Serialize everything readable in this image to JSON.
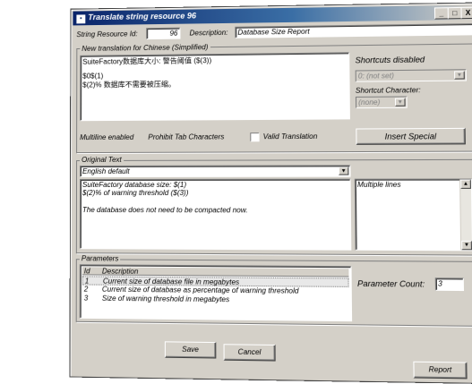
{
  "window": {
    "title": "Translate string resource 96",
    "btn_min": "_",
    "btn_max": "□",
    "btn_close": "X"
  },
  "string_resource": {
    "label": "String Resource Id:",
    "value": "96"
  },
  "description": {
    "label": "Description:",
    "value": "Database Size Report"
  },
  "new_translation": {
    "group_label": "New translation for Chinese (Simplified)",
    "lines": [
      "SuiteFactory数据库大小:  警告阈值 ($(3))",
      "",
      "$0$(1)",
      "$(2)% 数据库不需要被压缩。"
    ]
  },
  "shortcuts": {
    "status": "Shortcuts disabled",
    "select_value": "0: (not set)",
    "char_label": "Shortcut Character:",
    "char_value": "(none)"
  },
  "flags": {
    "multiline": "Multiline enabled",
    "prohibit_tabs": "Prohibit Tab Characters",
    "valid_label": "Valid Translation"
  },
  "insert_special_button": "Insert Special",
  "original_text": {
    "group_label": "Original Text",
    "language": "English default",
    "lines": [
      "SuiteFactory database size: $(1)",
      "$(2)% of warning threshold ($(3))",
      "",
      "The database does not need to be compacted now."
    ],
    "side_note": "Multiple lines"
  },
  "parameters": {
    "group_label": "Parameters",
    "columns": [
      "Id",
      "Description"
    ],
    "rows": [
      {
        "id": "1",
        "desc": "Current size of database file in megabytes"
      },
      {
        "id": "2",
        "desc": "Current size of database as percentage of warning threshold"
      },
      {
        "id": "3",
        "desc": "Size of warning threshold in megabytes"
      }
    ],
    "count_label": "Parameter Count:",
    "count_value": "3"
  },
  "buttons": {
    "save": "Save",
    "cancel": "Cancel",
    "report": "Report"
  },
  "colors": {
    "titlebar": "#0a246a",
    "face": "#d4d0c8",
    "selection": "#e8e8e8"
  }
}
